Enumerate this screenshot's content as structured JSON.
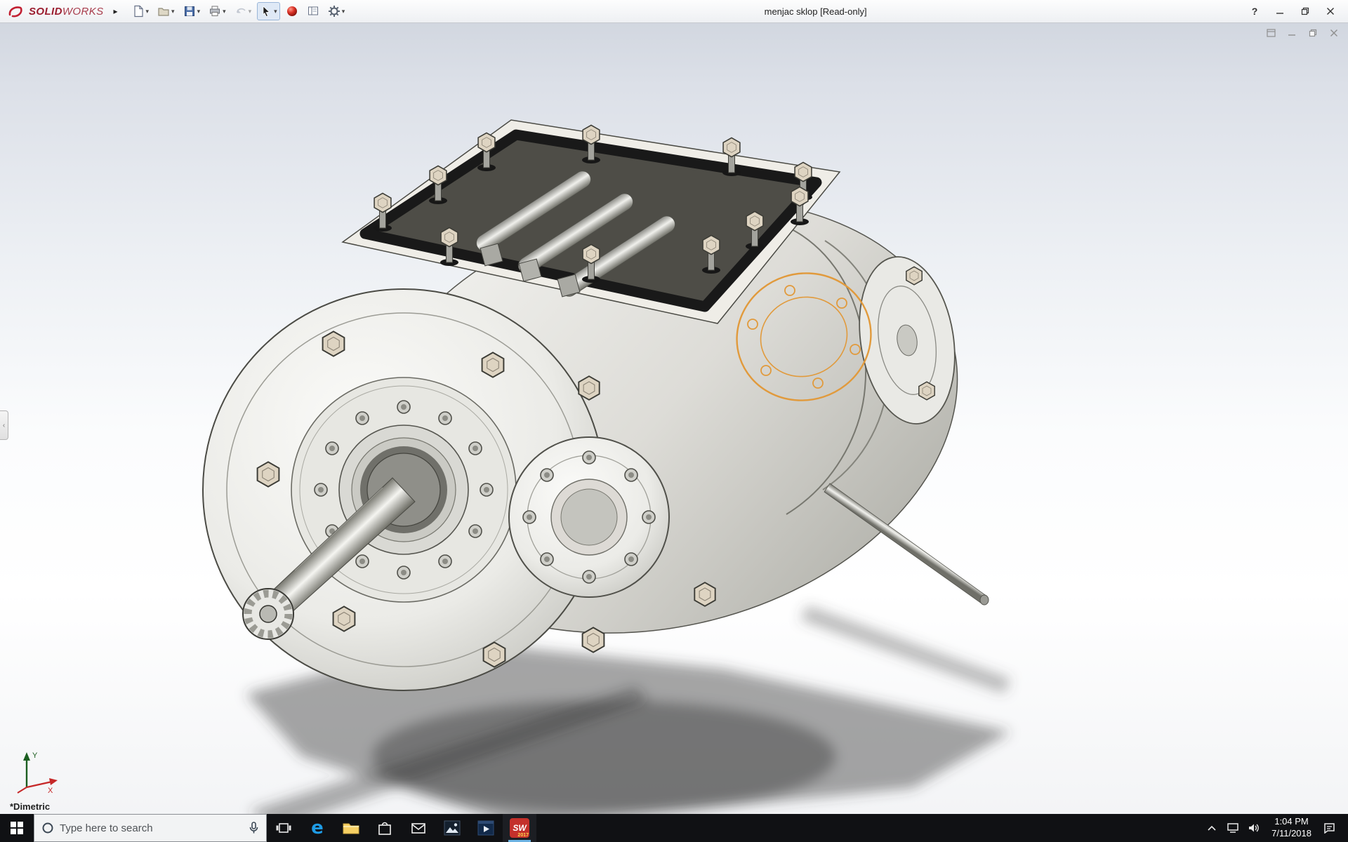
{
  "app": {
    "brand_bold": "SOLID",
    "brand_light": "WORKS",
    "title": "menjac sklop [Read-only]",
    "help_label": "?",
    "view_label": "*Dimetric"
  },
  "toolbar": {
    "items": [
      "new-document",
      "open",
      "save",
      "print",
      "undo",
      "select",
      "appearances",
      "display-settings",
      "options"
    ],
    "active_tool": "select"
  },
  "titlebar_controls": [
    "help",
    "minimize",
    "maximize",
    "close"
  ],
  "viewport": {
    "doc_controls": [
      "float-window",
      "minimize",
      "restore",
      "close"
    ],
    "triad_x": "X",
    "triad_y": "Y",
    "highlight_color": "#E19A3C",
    "background_top": "#D2D7E0",
    "background_bottom": "#FFFFFF"
  },
  "taskbar": {
    "search_placeholder": "Type here to search",
    "edge_glyph": "e",
    "sw_label": "SW",
    "sw_year": "2017",
    "clock_time": "1:04 PM",
    "clock_date": "7/11/2018",
    "apps": [
      "task-view",
      "edge",
      "file-explorer",
      "store",
      "mail",
      "photos",
      "movies-tv",
      "solidworks-2017"
    ],
    "tray": [
      "hidden-icons",
      "network",
      "volume",
      "clock",
      "action-center",
      "show-desktop"
    ]
  }
}
